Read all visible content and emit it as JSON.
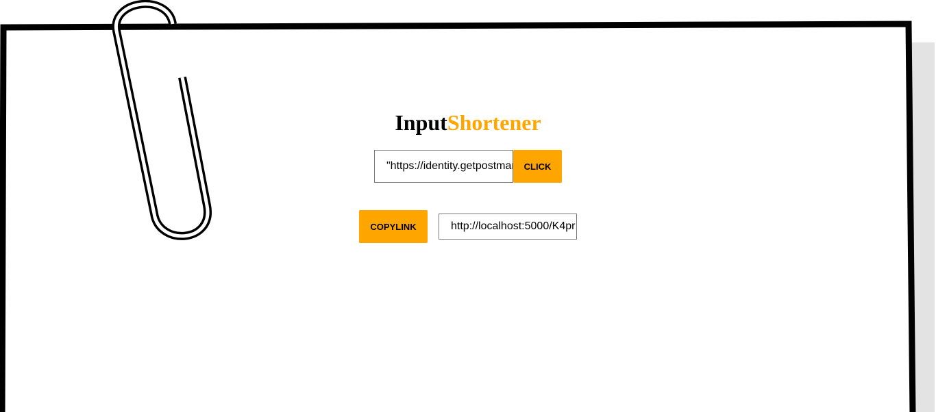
{
  "header": {
    "title_part1": "Input",
    "title_part2": "Shortener"
  },
  "form": {
    "url_value": "\"https://identity.getpostman.com",
    "click_label": "CLICK"
  },
  "result": {
    "copy_label": "COPYLINK",
    "short_url_value": "http://localhost:5000/K4pr"
  },
  "colors": {
    "accent": "#ffa500",
    "frame": "#000000",
    "shadow": "#e3e3e3",
    "background": "#ffffff"
  },
  "icons": {
    "decoration": "paperclip-icon"
  }
}
